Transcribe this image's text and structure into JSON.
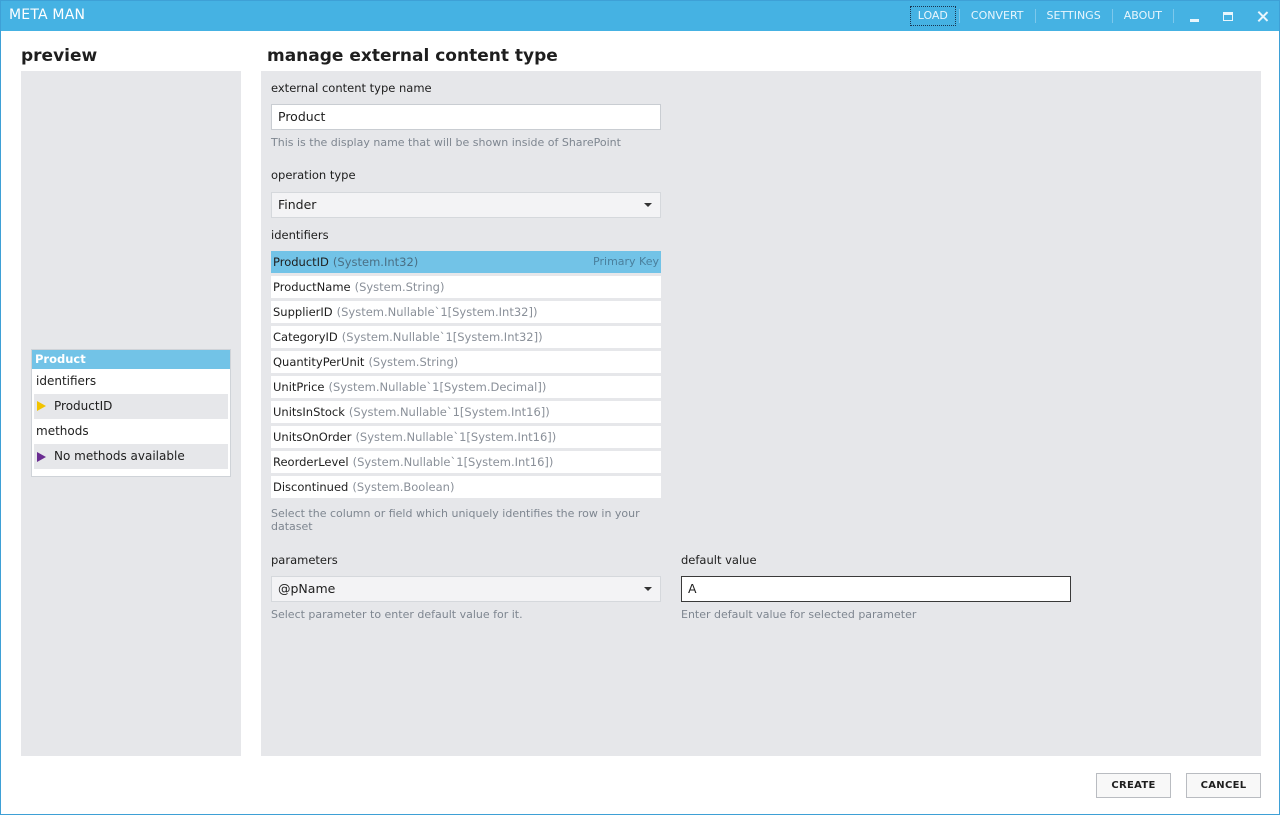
{
  "app": {
    "title": "META MAN"
  },
  "nav": {
    "load": "LOAD",
    "convert": "CONVERT",
    "settings": "SETTINGS",
    "about": "ABOUT"
  },
  "preview": {
    "title": "preview",
    "card": {
      "header": "Product",
      "identifiers_label": "identifiers",
      "identifier_item": "ProductID",
      "methods_label": "methods",
      "methods_item": "No methods available"
    }
  },
  "main": {
    "title": "manage external content type",
    "name_field": {
      "label": "external content type name",
      "value": "Product",
      "hint": "This is the display name that will be shown inside of SharePoint"
    },
    "operation": {
      "label": "operation type",
      "value": "Finder"
    },
    "identifiers": {
      "label": "identifiers",
      "rows": [
        {
          "name": "ProductID",
          "type": "(System.Int32)",
          "badge": "Primary Key"
        },
        {
          "name": "ProductName",
          "type": "(System.String)"
        },
        {
          "name": "SupplierID",
          "type": "(System.Nullable`1[System.Int32])"
        },
        {
          "name": "CategoryID",
          "type": "(System.Nullable`1[System.Int32])"
        },
        {
          "name": "QuantityPerUnit",
          "type": "(System.String)"
        },
        {
          "name": "UnitPrice",
          "type": "(System.Nullable`1[System.Decimal])"
        },
        {
          "name": "UnitsInStock",
          "type": "(System.Nullable`1[System.Int16])"
        },
        {
          "name": "UnitsOnOrder",
          "type": "(System.Nullable`1[System.Int16])"
        },
        {
          "name": "ReorderLevel",
          "type": "(System.Nullable`1[System.Int16])"
        },
        {
          "name": "Discontinued",
          "type": "(System.Boolean)"
        }
      ],
      "hint": "Select the column or field which uniquely identifies the row in your dataset"
    },
    "parameters": {
      "label": "parameters",
      "value": "@pName",
      "hint": "Select parameter to enter default value for it."
    },
    "default_value": {
      "label": "default value",
      "value": "A",
      "hint": "Enter default value for selected parameter"
    }
  },
  "footer": {
    "create": "CREATE",
    "cancel": "CANCEL"
  },
  "colors": {
    "titlebar": "#45b2e3",
    "selection": "#72c3e7",
    "panel": "#e6e7ea",
    "identifier_marker": "#f2c300",
    "method_marker": "#6a2c91"
  },
  "icons": {
    "minimize": "minimize-icon",
    "maximize": "maximize-icon",
    "close": "close-icon",
    "dropdown": "chevron-down-icon"
  }
}
